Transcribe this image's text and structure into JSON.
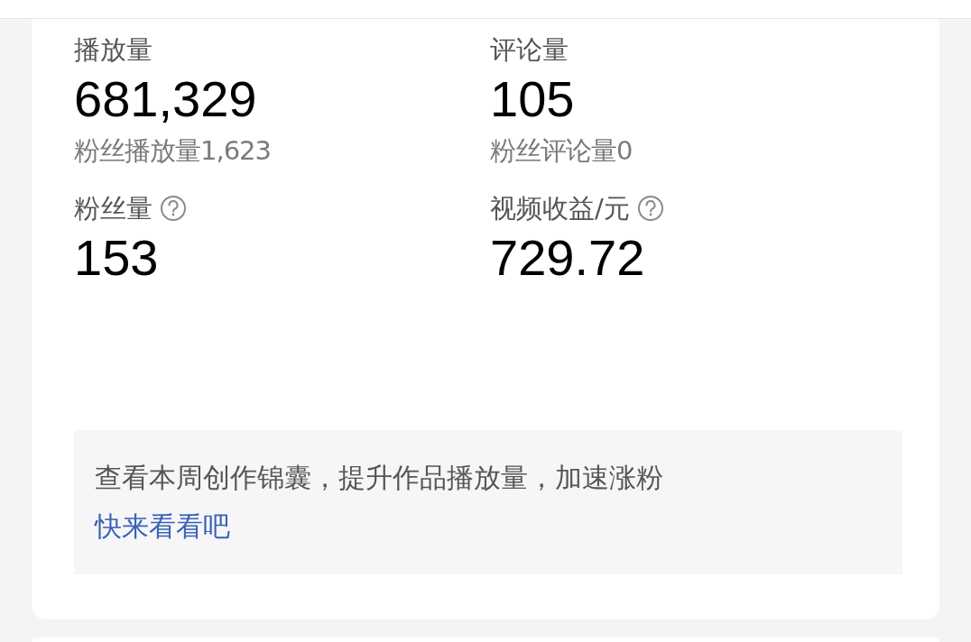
{
  "stats": [
    {
      "label": "播放量",
      "value": "681,329",
      "sub": "粉丝播放量1,623",
      "help": false
    },
    {
      "label": "评论量",
      "value": "105",
      "sub": "粉丝评论量0",
      "help": false
    },
    {
      "label": "粉丝量",
      "value": "153",
      "help": true
    },
    {
      "label": "视频收益/元",
      "value": "729.72",
      "help": true
    }
  ],
  "tip": {
    "text": "查看本周创作锦囊，提升作品播放量，加速涨粉",
    "link": "快来看看吧"
  }
}
